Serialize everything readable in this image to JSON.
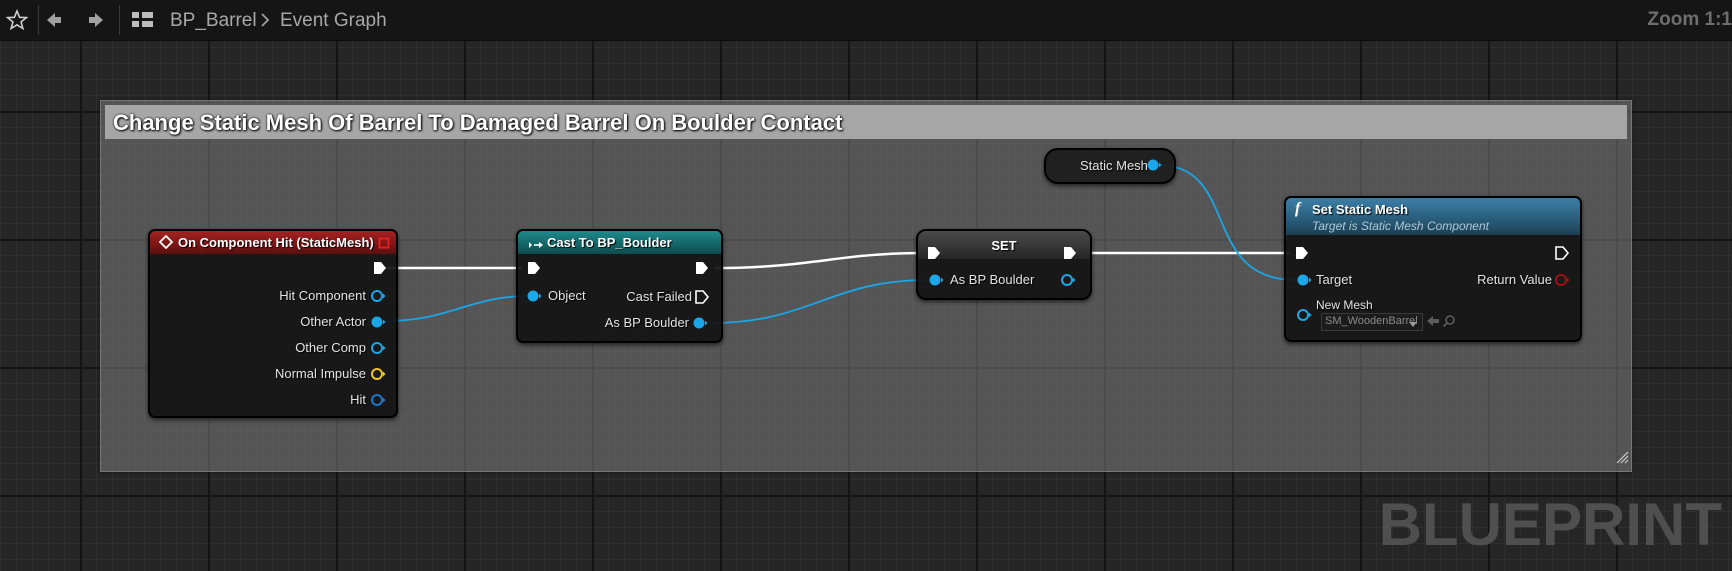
{
  "toolbar": {
    "favorite_icon": "star-icon",
    "back_icon": "arrow-left-icon",
    "forward_icon": "arrow-right-icon",
    "graph_icon": "graph-icon",
    "breadcrumb": [
      "BP_Barrel",
      "Event Graph"
    ],
    "separator_icon": "chevron-right-icon",
    "zoom_label": "Zoom 1:1"
  },
  "comment": {
    "title": "Change Static Mesh Of Barrel To Damaged Barrel On Boulder Contact"
  },
  "nodes": {
    "event_hit": {
      "title": "On Component Hit (StaticMesh)",
      "pins": [
        "Hit Component",
        "Other Actor",
        "Other Comp",
        "Normal Impulse",
        "Hit"
      ]
    },
    "cast": {
      "title": "Cast To BP_Boulder",
      "inputs": [
        "Object"
      ],
      "outputs": [
        "Cast Failed",
        "As BP Boulder"
      ]
    },
    "set_var": {
      "title": "SET",
      "pin": "As BP Boulder"
    },
    "static_mesh_var": {
      "label": "Static Mesh"
    },
    "set_static_mesh": {
      "title": "Set Static Mesh",
      "subtitle": "Target is Static Mesh Component",
      "inputs": [
        "Target",
        "New Mesh"
      ],
      "outputs": [
        "Return Value"
      ],
      "new_mesh_value": "SM_WoodenBarrel"
    }
  },
  "colors": {
    "exec": "#ffffff",
    "object_pin": "#1aa6e8",
    "struct_pin": "#0b5ea8",
    "vector_pin": "#f2c42a",
    "bool_pin": "#8c1010",
    "event_header": "#8c1818",
    "cast_header": "#167072",
    "function_header": "#2e6a90"
  },
  "watermark": "BLUEPRINT"
}
